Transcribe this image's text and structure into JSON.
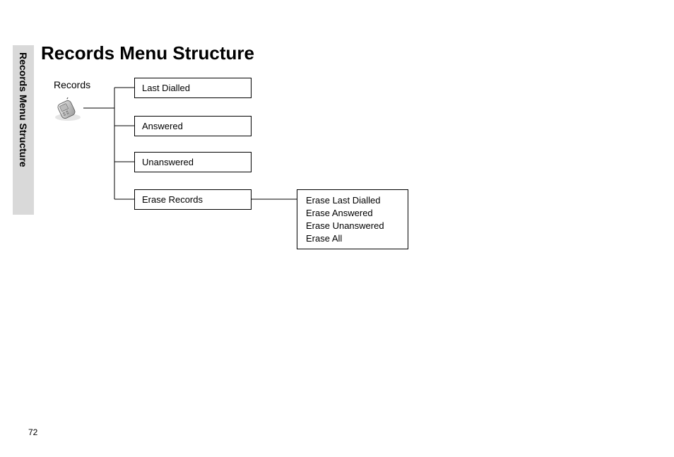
{
  "sideTab": "Records Menu Structure",
  "pageTitle": "Records Menu Structure",
  "rootLabel": "Records",
  "menuItems": [
    "Last Dialled",
    "Answered",
    "Unanswered",
    "Erase Records"
  ],
  "submenuItems": [
    "Erase Last Dialled",
    "Erase Answered",
    "Erase Unanswered",
    "Erase All"
  ],
  "pageNumber": "72"
}
